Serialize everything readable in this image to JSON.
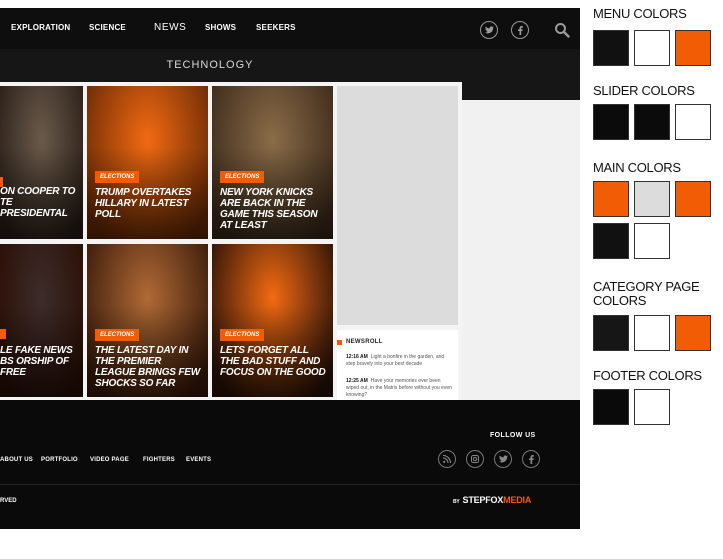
{
  "nav": {
    "items": [
      "EXPLORATION",
      "SCIENCE",
      "NEWS",
      "SHOWS",
      "SEEKERS"
    ]
  },
  "category": {
    "title": "TECHNOLOGY"
  },
  "tiles": [
    {
      "badge": "ELECTIONS",
      "headline": "ON COOPER TO TE PRESIDENTAL",
      "colors": {
        "top": "#6a5a4a",
        "bottom": "#2a1f18",
        "overlay": "#f25c05"
      }
    },
    {
      "badge": "ELECTIONS",
      "headline": "TRUMP OVERTAKES HILLARY IN LATEST POLL",
      "colors": {
        "top": "#f26a12",
        "bottom": "#6b2a05",
        "overlay": "#f25c05"
      }
    },
    {
      "badge": "ELECTIONS",
      "headline": "NEW YORK KNICKS ARE BACK IN THE GAME THIS SEASON AT LEAST",
      "colors": {
        "top": "#8a6c48",
        "bottom": "#3c2a1a",
        "overlay": "#f25c05"
      }
    },
    {
      "badge": "",
      "headline": "LE FAKE NEWS BS ORSHIP OF FREE",
      "colors": {
        "top": "#3d2c2a",
        "bottom": "#2a0f05",
        "overlay": "#f25c05"
      }
    },
    {
      "badge": "ELECTIONS",
      "headline": "THE LATEST DAY IN THE PREMIER LEAGUE BRINGS FEW SHOCKS SO FAR",
      "colors": {
        "top": "#b06a35",
        "bottom": "#3a1a0a",
        "overlay": "#f25c05"
      }
    },
    {
      "badge": "ELECTIONS",
      "headline": "LETS FORGET ALL THE BAD STUFF AND FOCUS ON THE GOOD",
      "colors": {
        "top": "#f26a12",
        "bottom": "#2a1208",
        "overlay": "#f25c05"
      }
    }
  ],
  "newsroll": {
    "title": "NEWSROLL",
    "items": [
      {
        "time": "12:16 AM",
        "text": "Light a bonfire in the garden, and step bravely into your best decade"
      },
      {
        "time": "12:25 AM",
        "text": "Have your memories ever been wiped out, in the Matrix before without you even knowing?"
      }
    ]
  },
  "footer": {
    "follow_label": "FOLLOW US",
    "links": [
      "ABOUT US",
      "PORTFOLIO",
      "VIDEO PAGE",
      "FIGHTERS",
      "EVENTS"
    ],
    "copyright": "RVED",
    "byline_prefix": "BY",
    "byline_brand": "STEPFOX",
    "byline_accent": "MEDIA"
  },
  "color_groups": [
    {
      "title": "MENU COLORS",
      "swatches": [
        "#111111",
        "#ffffff",
        "#f25c05"
      ]
    },
    {
      "title": "SLIDER COLORS",
      "swatches": [
        "#0b0b0b",
        "#0b0b0b",
        "#ffffff"
      ]
    },
    {
      "title": "MAIN COLORS",
      "swatches": [
        "#f25c05",
        "#dcdcdc",
        "#f25c05",
        "#111111",
        "#ffffff"
      ]
    },
    {
      "title": "CATEGORY PAGE COLORS",
      "swatches": [
        "#161616",
        "#ffffff",
        "#f25c05"
      ]
    },
    {
      "title": "FOOTER COLORS",
      "swatches": [
        "#0a0a0a",
        "#ffffff"
      ]
    }
  ],
  "accent_color": "#f25c05"
}
